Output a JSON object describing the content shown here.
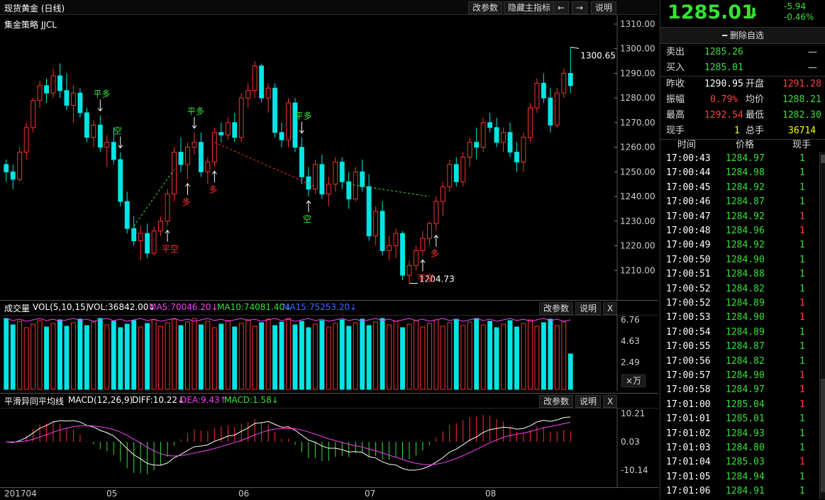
{
  "main_chart": {
    "title": "现货黄金 (日线)",
    "strategy_label": "集金策略 JJCL",
    "buttons": [
      "改参数",
      "隐藏主指标",
      "←",
      "→",
      "说明"
    ],
    "y_labels": [
      "1310.00",
      "1300.00",
      "1290.00",
      "1280.00",
      "1270.00",
      "1260.00",
      "1250.00",
      "1240.00",
      "1230.00",
      "1220.00",
      "1210.00"
    ],
    "high_label": "1300.65",
    "low_label": "1204.73",
    "signals": {
      "ping_duo": "平多",
      "kong": "空",
      "duo": "多",
      "ping_kong": "平空"
    }
  },
  "volume": {
    "title": "成交量",
    "params": "VOL(5,10,15)",
    "vol": "VOL:36842.00↓",
    "ma5": "MA5:70046.20↓",
    "ma10": "MA10:74081.40↓",
    "ma15": "MA15:75253.20↓",
    "buttons": [
      "改参数",
      "说明",
      "X"
    ],
    "y_labels": [
      "6.76",
      "4.63",
      "2.49"
    ],
    "unit_button": "×万"
  },
  "macd": {
    "title": "平滑异同平均线",
    "params": "MACD(12,26,9)",
    "diff": "DIFF:10.22↓",
    "dea": "DEA:9.43↑",
    "macd": "MACD:1.58↓",
    "buttons": [
      "改参数",
      "说明",
      "X"
    ],
    "y_labels": [
      "10.21",
      "0.03",
      "-10.14"
    ]
  },
  "x_axis": [
    "201704",
    "05",
    "06",
    "07",
    "08"
  ],
  "quote": {
    "price": "1285.01",
    "arrow": "⬇",
    "change": "-5.94",
    "change_pct": "-0.46%",
    "remove_watch": "删除自选",
    "sell_label": "卖出",
    "sell": "1285.26",
    "sell_vol": "—",
    "buy_label": "买入",
    "buy": "1285.01",
    "buy_vol": "—",
    "prev_close_label": "昨收",
    "prev_close": "1290.95",
    "open_label": "开盘",
    "open": "1291.28",
    "amp_label": "振幅",
    "amp": "0.79%",
    "avg_label": "均价",
    "avg": "1288.21",
    "high_label": "最高",
    "high": "1292.54",
    "low_label": "最低",
    "low": "1282.30",
    "cur_vol_label": "现手",
    "cur_vol": "1",
    "total_vol_label": "总手",
    "total_vol": "36714"
  },
  "ticks_header": {
    "time": "时间",
    "price": "价格",
    "vol": "现手"
  },
  "ticks": [
    {
      "t": "17:00:43",
      "p": "1284.97",
      "v": "1",
      "c": "grn"
    },
    {
      "t": "17:00:44",
      "p": "1284.98",
      "v": "1",
      "c": "grn"
    },
    {
      "t": "17:00:45",
      "p": "1284.92",
      "v": "1",
      "c": "grn"
    },
    {
      "t": "17:00:46",
      "p": "1284.87",
      "v": "1",
      "c": "grn"
    },
    {
      "t": "17:00:47",
      "p": "1284.92",
      "v": "1",
      "c": "red"
    },
    {
      "t": "17:00:48",
      "p": "1284.96",
      "v": "1",
      "c": "red"
    },
    {
      "t": "17:00:49",
      "p": "1284.92",
      "v": "1",
      "c": "grn"
    },
    {
      "t": "17:00:50",
      "p": "1284.90",
      "v": "1",
      "c": "grn"
    },
    {
      "t": "17:00:51",
      "p": "1284.88",
      "v": "1",
      "c": "grn"
    },
    {
      "t": "17:00:52",
      "p": "1284.82",
      "v": "1",
      "c": "grn"
    },
    {
      "t": "17:00:52",
      "p": "1284.89",
      "v": "1",
      "c": "red"
    },
    {
      "t": "17:00:53",
      "p": "1284.90",
      "v": "1",
      "c": "red"
    },
    {
      "t": "17:00:54",
      "p": "1284.89",
      "v": "1",
      "c": "grn"
    },
    {
      "t": "17:00:55",
      "p": "1284.87",
      "v": "1",
      "c": "grn"
    },
    {
      "t": "17:00:56",
      "p": "1284.82",
      "v": "1",
      "c": "grn"
    },
    {
      "t": "17:00:57",
      "p": "1284.90",
      "v": "1",
      "c": "red"
    },
    {
      "t": "17:00:58",
      "p": "1284.97",
      "v": "1",
      "c": "red"
    },
    {
      "t": "17:01:00",
      "p": "1285.04",
      "v": "1",
      "c": "red"
    },
    {
      "t": "17:01:01",
      "p": "1285.01",
      "v": "1",
      "c": "grn"
    },
    {
      "t": "17:01:02",
      "p": "1284.93",
      "v": "1",
      "c": "grn"
    },
    {
      "t": "17:01:03",
      "p": "1284.80",
      "v": "1",
      "c": "grn"
    },
    {
      "t": "17:01:04",
      "p": "1285.03",
      "v": "1",
      "c": "red"
    },
    {
      "t": "17:01:05",
      "p": "1284.94",
      "v": "1",
      "c": "grn"
    },
    {
      "t": "17:01:06",
      "p": "1284.91",
      "v": "1",
      "c": "grn"
    }
  ],
  "chart_data": {
    "type": "candlestick",
    "title": "现货黄金 (日线)",
    "ylim": [
      1200,
      1312
    ],
    "high": 1300.65,
    "low": 1204.73,
    "candles": [
      [
        1253,
        1255,
        1246,
        1250
      ],
      [
        1250,
        1253,
        1243,
        1247
      ],
      [
        1247,
        1260,
        1246,
        1258
      ],
      [
        1258,
        1270,
        1255,
        1268
      ],
      [
        1268,
        1280,
        1266,
        1279
      ],
      [
        1279,
        1287,
        1276,
        1285
      ],
      [
        1285,
        1288,
        1278,
        1282
      ],
      [
        1282,
        1292,
        1280,
        1289
      ],
      [
        1289,
        1294,
        1280,
        1283
      ],
      [
        1283,
        1290,
        1275,
        1277
      ],
      [
        1277,
        1285,
        1270,
        1282
      ],
      [
        1282,
        1284,
        1272,
        1274
      ],
      [
        1274,
        1276,
        1262,
        1264
      ],
      [
        1264,
        1271,
        1260,
        1269
      ],
      [
        1269,
        1273,
        1258,
        1260
      ],
      [
        1260,
        1265,
        1252,
        1262
      ],
      [
        1262,
        1268,
        1253,
        1255
      ],
      [
        1255,
        1258,
        1236,
        1238
      ],
      [
        1238,
        1242,
        1225,
        1227
      ],
      [
        1227,
        1232,
        1220,
        1222
      ],
      [
        1222,
        1228,
        1214,
        1225
      ],
      [
        1225,
        1229,
        1215,
        1217
      ],
      [
        1217,
        1228,
        1216,
        1226
      ],
      [
        1226,
        1232,
        1224,
        1230
      ],
      [
        1230,
        1243,
        1228,
        1241
      ],
      [
        1241,
        1260,
        1238,
        1258
      ],
      [
        1258,
        1264,
        1250,
        1253
      ],
      [
        1253,
        1262,
        1247,
        1260
      ],
      [
        1260,
        1266,
        1257,
        1262
      ],
      [
        1262,
        1266,
        1248,
        1250
      ],
      [
        1250,
        1256,
        1245,
        1254
      ],
      [
        1254,
        1268,
        1252,
        1266
      ],
      [
        1266,
        1270,
        1262,
        1265
      ],
      [
        1265,
        1272,
        1263,
        1270
      ],
      [
        1270,
        1274,
        1262,
        1264
      ],
      [
        1264,
        1282,
        1262,
        1280
      ],
      [
        1280,
        1286,
        1276,
        1283
      ],
      [
        1283,
        1295,
        1280,
        1293
      ],
      [
        1293,
        1294,
        1278,
        1280
      ],
      [
        1280,
        1286,
        1274,
        1284
      ],
      [
        1284,
        1286,
        1264,
        1266
      ],
      [
        1266,
        1270,
        1260,
        1263
      ],
      [
        1263,
        1280,
        1260,
        1278
      ],
      [
        1278,
        1280,
        1258,
        1260
      ],
      [
        1260,
        1264,
        1245,
        1248
      ],
      [
        1248,
        1252,
        1240,
        1243
      ],
      [
        1243,
        1255,
        1241,
        1253
      ],
      [
        1253,
        1257,
        1239,
        1241
      ],
      [
        1241,
        1248,
        1236,
        1245
      ],
      [
        1245,
        1256,
        1242,
        1254
      ],
      [
        1254,
        1256,
        1243,
        1246
      ],
      [
        1246,
        1250,
        1235,
        1239
      ],
      [
        1239,
        1252,
        1238,
        1250
      ],
      [
        1250,
        1255,
        1242,
        1244
      ],
      [
        1244,
        1249,
        1222,
        1224
      ],
      [
        1224,
        1236,
        1220,
        1234
      ],
      [
        1234,
        1238,
        1216,
        1218
      ],
      [
        1218,
        1224,
        1214,
        1220
      ],
      [
        1220,
        1227,
        1215,
        1225
      ],
      [
        1225,
        1226,
        1206,
        1208
      ],
      [
        1208,
        1214,
        1204.73,
        1212
      ],
      [
        1212,
        1220,
        1210,
        1218
      ],
      [
        1218,
        1226,
        1216,
        1223
      ],
      [
        1223,
        1230,
        1220,
        1229
      ],
      [
        1229,
        1240,
        1226,
        1238
      ],
      [
        1238,
        1246,
        1232,
        1244
      ],
      [
        1244,
        1255,
        1242,
        1253
      ],
      [
        1253,
        1256,
        1244,
        1246
      ],
      [
        1246,
        1258,
        1244,
        1256
      ],
      [
        1256,
        1264,
        1252,
        1262
      ],
      [
        1262,
        1268,
        1255,
        1260
      ],
      [
        1260,
        1272,
        1258,
        1270
      ],
      [
        1270,
        1274,
        1266,
        1268
      ],
      [
        1268,
        1272,
        1260,
        1262
      ],
      [
        1262,
        1268,
        1258,
        1266
      ],
      [
        1266,
        1270,
        1256,
        1258
      ],
      [
        1258,
        1262,
        1250,
        1254
      ],
      [
        1254,
        1266,
        1250,
        1264
      ],
      [
        1264,
        1278,
        1262,
        1276
      ],
      [
        1276,
        1288,
        1274,
        1286
      ],
      [
        1286,
        1290,
        1278,
        1280
      ],
      [
        1280,
        1284,
        1266,
        1269
      ],
      [
        1269,
        1284,
        1268,
        1282
      ],
      [
        1282,
        1292,
        1280,
        1290
      ],
      [
        1290,
        1300.65,
        1282,
        1285
      ]
    ]
  }
}
